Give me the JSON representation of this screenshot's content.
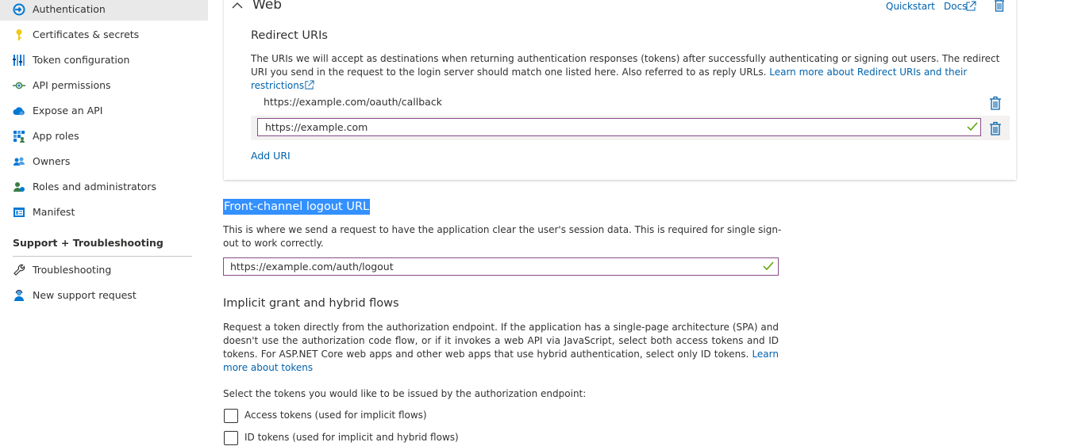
{
  "sidebar": {
    "items": [
      {
        "label": "Authentication",
        "icon": "authentication-icon",
        "active": true
      },
      {
        "label": "Certificates & secrets",
        "icon": "key-icon"
      },
      {
        "label": "Token configuration",
        "icon": "token-config-icon"
      },
      {
        "label": "API permissions",
        "icon": "api-permissions-icon"
      },
      {
        "label": "Expose an API",
        "icon": "cloud-icon"
      },
      {
        "label": "App roles",
        "icon": "app-roles-icon"
      },
      {
        "label": "Owners",
        "icon": "owners-icon"
      },
      {
        "label": "Roles and administrators",
        "icon": "roles-admins-icon"
      },
      {
        "label": "Manifest",
        "icon": "manifest-icon"
      }
    ],
    "support_heading": "Support + Troubleshooting",
    "support_items": [
      {
        "label": "Troubleshooting",
        "icon": "wrench-icon"
      },
      {
        "label": "New support request",
        "icon": "support-person-icon"
      }
    ]
  },
  "web": {
    "title": "Web",
    "quickstart": "Quickstart",
    "docs": "Docs",
    "redirect_title": "Redirect URIs",
    "redirect_desc": "The URIs we will accept as destinations when returning authentication responses (tokens) after successfully authenticating or signing out users. The redirect URI you send in the request to the login server should match one listed here. Also referred to as reply URLs.",
    "redirect_link": "Learn more about Redirect URIs and their restrictions",
    "uris": [
      "https://example.com/oauth/callback",
      "https://example.com"
    ],
    "add_uri": "Add URI"
  },
  "logout": {
    "title": "Front-channel logout URL",
    "desc": "This is where we send a request to have the application clear the user's session data. This is required for single sign-out to work correctly.",
    "value": "https://example.com/auth/logout"
  },
  "implicit": {
    "title": "Implicit grant and hybrid flows",
    "desc": "Request a token directly from the authorization endpoint. If the application has a single-page architecture (SPA) and doesn't use the authorization code flow, or if it invokes a web API via JavaScript, select both access tokens and ID tokens. For ASP.NET Core web apps and other web apps that use hybrid authentication, select only ID tokens.",
    "desc_link": "Learn more about tokens",
    "select_label": "Select the tokens you would like to be issued by the authorization endpoint:",
    "access_tokens": "Access tokens (used for implicit flows)",
    "id_tokens": "ID tokens (used for implicit and hybrid flows)"
  },
  "colors": {
    "link": "#0062ad",
    "input_border": "#8a4a8a",
    "valid_check": "#57a300",
    "selection": "#3390ff"
  }
}
